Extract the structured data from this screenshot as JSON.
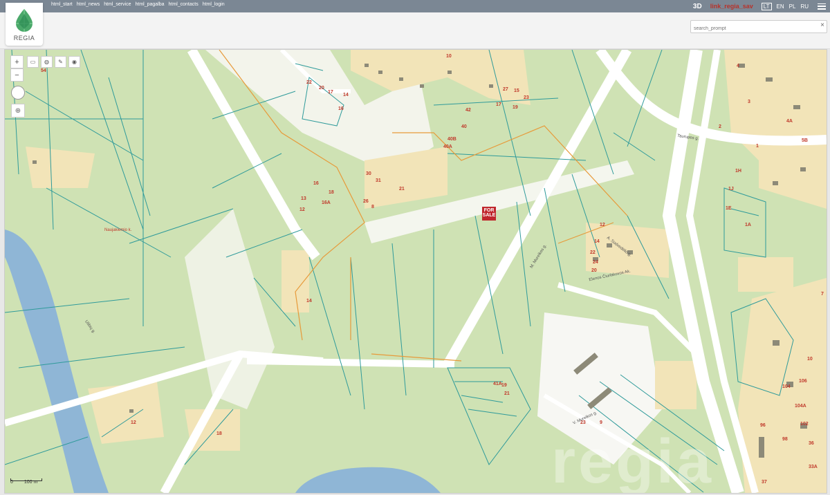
{
  "nav": {
    "links": [
      "html_start",
      "html_news",
      "html_service",
      "html_pagalba",
      "html_contacts",
      "html_login"
    ],
    "mode_3d": "3D",
    "regia_link": "link_regia_sav",
    "languages": [
      "LT",
      "EN",
      "PL",
      "RU"
    ],
    "active_language": "LT"
  },
  "header": {
    "logo_text": "REGIA",
    "search_placeholder": "search_prompt",
    "clear_symbol": "×"
  },
  "map": {
    "for_sale_line1": "FOR",
    "for_sale_line2": "SALE",
    "scale_zero": "0",
    "scale_label": "100 m",
    "watermark": "regia",
    "colors": {
      "land": "#cfe2b4",
      "water": "#8fb6d6",
      "road": "#ffffff",
      "parcel": "#2e9a9a",
      "residential": "#f2e4b8",
      "boundary": "#e79a3a"
    },
    "parcel_labels": [
      "54",
      "22",
      "20",
      "17",
      "14",
      "16",
      "10",
      "27",
      "15",
      "17",
      "19",
      "23",
      "42",
      "40",
      "40B",
      "40A",
      "30",
      "31",
      "21",
      "16",
      "18",
      "16A",
      "13",
      "12",
      "26",
      "4",
      "2",
      "3",
      "4A",
      "5B",
      "1",
      "1H",
      "1J",
      "1E",
      "1A",
      "12",
      "14",
      "22",
      "24",
      "20",
      "8",
      "7",
      "10",
      "106",
      "104",
      "104A",
      "102",
      "98",
      "96",
      "36",
      "33A",
      "37",
      "41A",
      "19",
      "21",
      "23",
      "18",
      "12",
      "14",
      "9",
      "15"
    ],
    "street_labels": [
      "Taurupes g.",
      "A. Sodvedėlio g.",
      "Elenos Čiurlakovos Ak.",
      "V. Mureikos g.",
      "Ulibių g.",
      "Naujakiemio k.",
      "M. Mureikos g."
    ]
  }
}
